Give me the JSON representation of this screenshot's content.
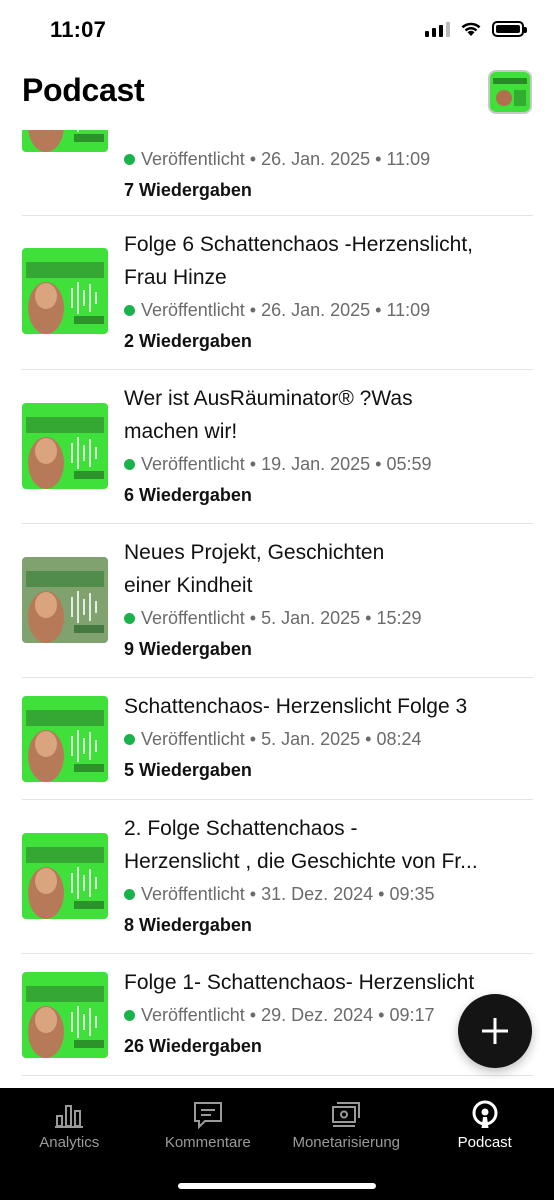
{
  "status_bar": {
    "time": "11:07"
  },
  "header": {
    "title": "Podcast"
  },
  "episodes": [
    {
      "title_line1": "",
      "title_line2": "",
      "status": "Veröffentlicht",
      "date": "26. Jan. 2025",
      "time": "11:09",
      "plays": "7 Wiedergaben",
      "cover": "green"
    },
    {
      "title_line1": "Folge 6 Schattenchaos -Herzenslicht,",
      "title_line2": "Frau Hinze",
      "status": "Veröffentlicht",
      "date": "26. Jan. 2025",
      "time": "11:09",
      "plays": "2 Wiedergaben",
      "cover": "green"
    },
    {
      "title_line1": "Wer ist AusRäuminator® ?Was",
      "title_line2": "machen wir!",
      "status": "Veröffentlicht",
      "date": "19. Jan. 2025",
      "time": "05:59",
      "plays": "6 Wiedergaben",
      "cover": "green"
    },
    {
      "title_line1": "Neues Projekt, Geschichten",
      "title_line2": "einer Kindheit",
      "status": "Veröffentlicht",
      "date": "5. Jan. 2025",
      "time": "15:29",
      "plays": "9 Wiedergaben",
      "cover": "gray"
    },
    {
      "title_line1": "Schattenchaos- Herzenslicht Folge 3",
      "title_line2": "",
      "status": "Veröffentlicht",
      "date": "5. Jan. 2025",
      "time": "08:24",
      "plays": "5 Wiedergaben",
      "cover": "green"
    },
    {
      "title_line1": "2. Folge Schattenchaos -",
      "title_line2": "Herzenslicht , die Geschichte von Fr...",
      "status": "Veröffentlicht",
      "date": "31. Dez. 2024",
      "time": "09:35",
      "plays": "8 Wiedergaben",
      "cover": "green"
    },
    {
      "title_line1": "Folge 1- Schattenchaos- Herzenslicht",
      "title_line2": "",
      "status": "Veröffentlicht",
      "date": "29. Dez. 2024",
      "time": "09:17",
      "plays": "26 Wiedergaben",
      "cover": "green"
    }
  ],
  "meta_separator": "•",
  "tabs": [
    {
      "label": "Analytics",
      "icon": "bar-chart-icon",
      "active": false
    },
    {
      "label": "Kommentare",
      "icon": "comment-icon",
      "active": false
    },
    {
      "label": "Monetarisierung",
      "icon": "money-icon",
      "active": false
    },
    {
      "label": "Podcast",
      "icon": "podcast-icon",
      "active": true
    }
  ],
  "colors": {
    "published_dot": "#1ab34b",
    "cover_green": "#3fe03a",
    "cover_gray": "#7fa26f",
    "tab_bar": "#000000"
  }
}
